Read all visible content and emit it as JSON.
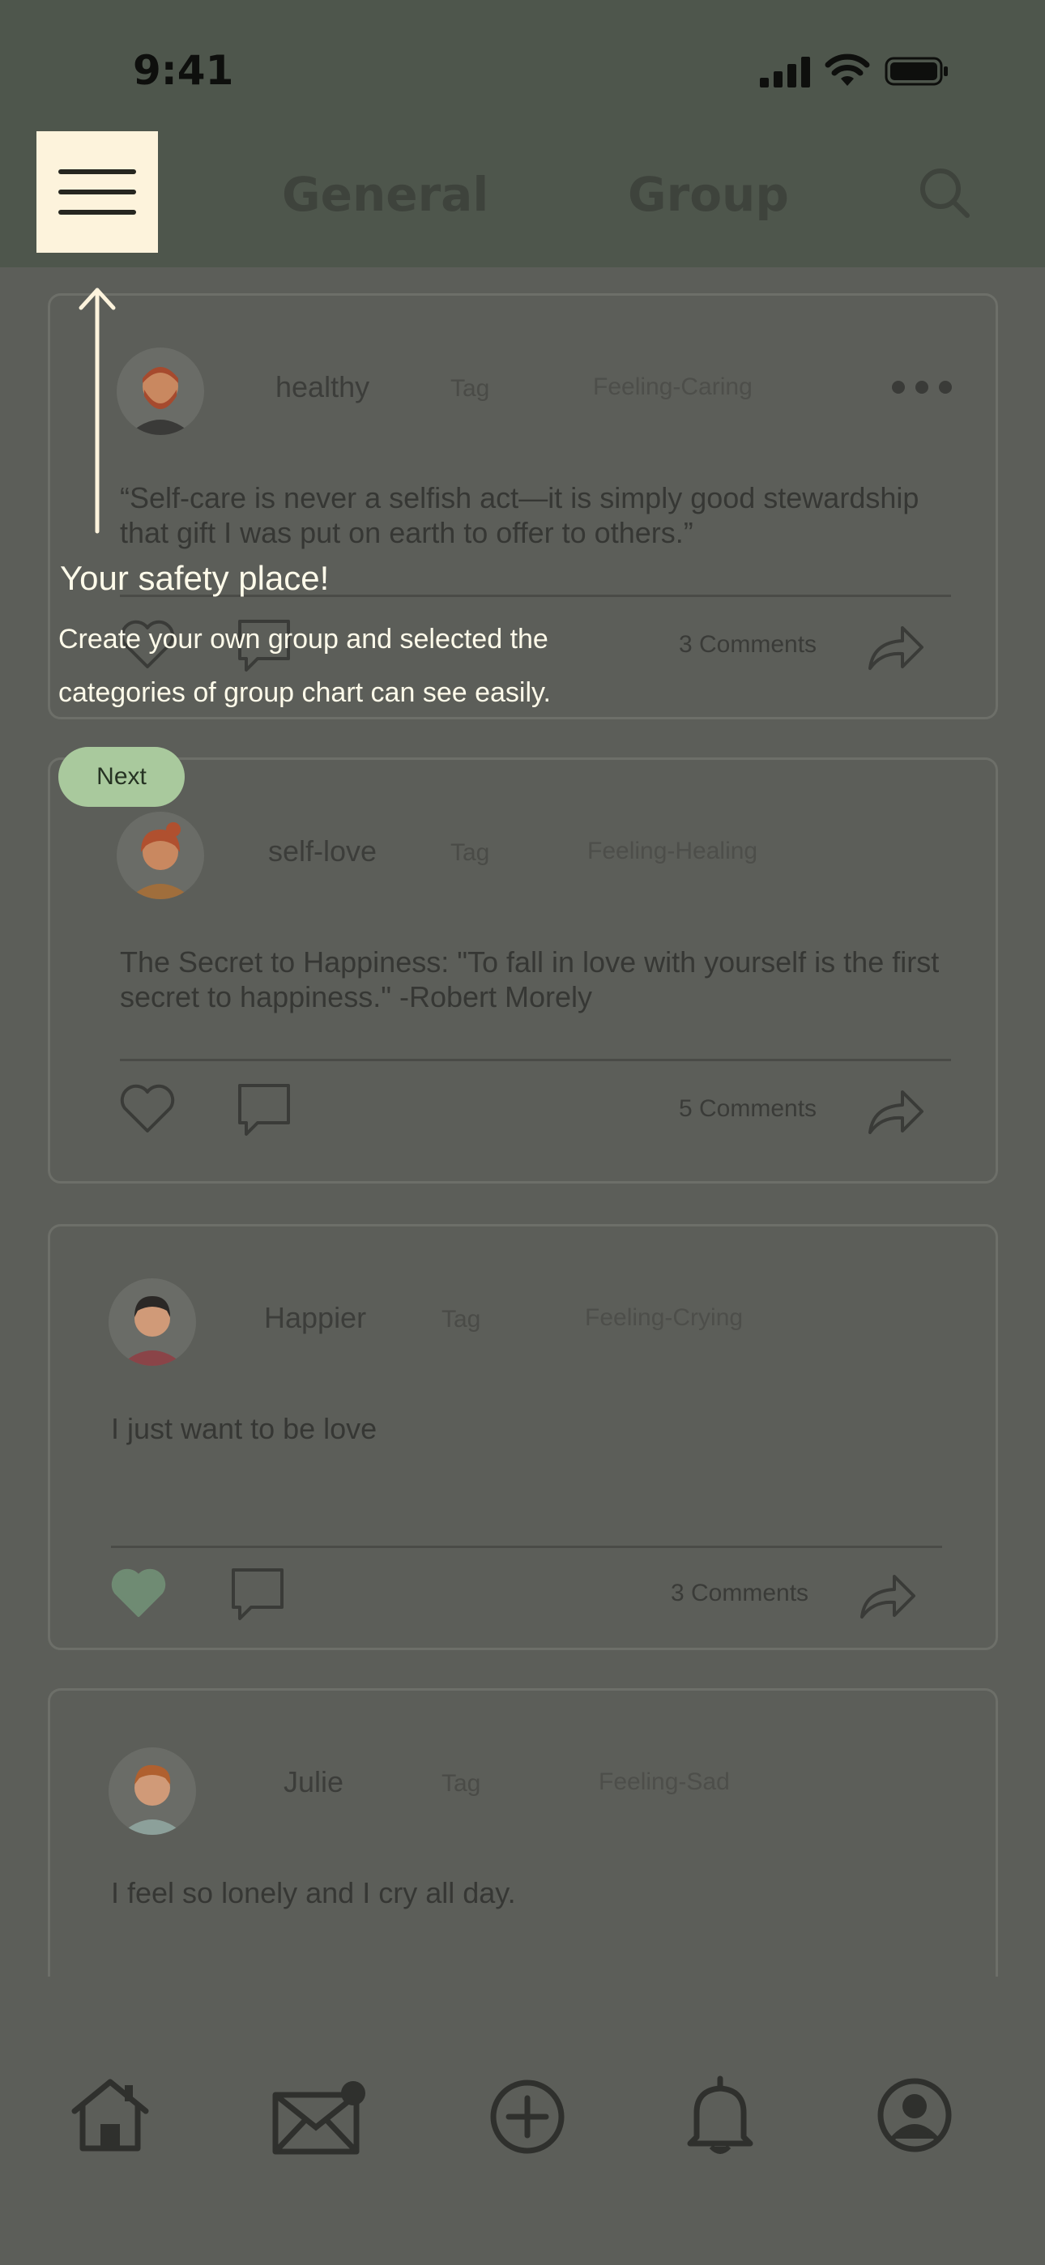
{
  "status_bar": {
    "time": "9:41"
  },
  "header": {
    "tabs": [
      "General",
      "Group"
    ],
    "menu_icon": "hamburger-menu-icon",
    "search_icon": "search-icon"
  },
  "posts": [
    {
      "username": "healthy",
      "tag": "Tag",
      "feeling": "Feeling-Caring",
      "text": "“Self-care is never a selfish act—it is simply good stewardship that gift I was put on earth to offer to others.”",
      "comments": "3 Comments",
      "liked": false
    },
    {
      "username": "self-love",
      "tag": "Tag",
      "feeling": "Feeling-Healing",
      "text": "The Secret to Happiness: \"To fall in love with yourself is the first secret to happiness.\" -Robert Morely",
      "comments": "5 Comments",
      "liked": false
    },
    {
      "username": "Happier",
      "tag": "Tag",
      "feeling": "Feeling-Crying",
      "text": "I just want to be love",
      "comments": "3 Comments",
      "liked": true
    },
    {
      "username": "Julie",
      "tag": "Tag",
      "feeling": "Feeling-Sad",
      "text": "I feel so lonely and I cry all day."
    }
  ],
  "onboarding": {
    "title": "Your safety place!",
    "body": "Create your own group and selected the categories of group chart can see easily.",
    "next_label": "Next"
  },
  "bottom_nav": [
    "home-icon",
    "mail-icon",
    "add-icon",
    "bell-icon",
    "profile-icon"
  ],
  "colors": {
    "highlight": "#fdf3dc",
    "accent_green": "#a9c99d",
    "liked_heart": "#6f8b73"
  }
}
